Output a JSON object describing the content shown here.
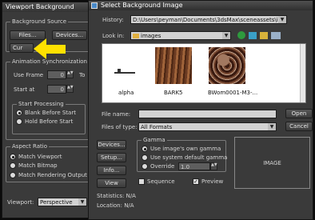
{
  "vb": {
    "title": "Viewport Background",
    "source_group": "Background Source",
    "files": "Files...",
    "devices": "Devices...",
    "cur": "Cur",
    "anim_group": "Animation Synchronization",
    "use_frame": "Use Frame",
    "use_frame_val": "0",
    "to": "To",
    "start_at": "Start at",
    "start_at_val": "0",
    "start_proc": "Start Processing",
    "blank": "Blank Before Start",
    "hold": "Hold Before Start",
    "aspect_group": "Aspect Ratio",
    "match_viewport": "Match Viewport",
    "match_bitmap": "Match Bitmap",
    "match_render": "Match Rendering Output",
    "viewport_label": "Viewport:",
    "viewport_value": "Perspective"
  },
  "sbi": {
    "title": "Select Background Image",
    "history_label": "History:",
    "history_value": "D:\\Users\\peyman\\Documents\\3dsMax\\sceneassets\\images",
    "lookin_label": "Look in:",
    "lookin_value": "images",
    "files": [
      {
        "name": "alpha"
      },
      {
        "name": "BARK5"
      },
      {
        "name": "BWom0001-M3-..."
      }
    ],
    "filename_label": "File name:",
    "filename_value": "",
    "open": "Open",
    "filetype_label": "Files of type:",
    "filetype_value": "All Formats",
    "cancel": "Cancel",
    "devices": "Devices...",
    "setup": "Setup...",
    "info": "Info...",
    "view": "View",
    "gamma_group": "Gamma",
    "gamma_own": "Use image's own gamma",
    "gamma_system": "Use system default gamma",
    "gamma_override": "Override",
    "gamma_override_val": "1.0",
    "sequence": "Sequence",
    "preview": "Preview",
    "image_label": "IMAGE",
    "stats_label": "Statistics: N/A",
    "location_label": "Location: N/A"
  }
}
